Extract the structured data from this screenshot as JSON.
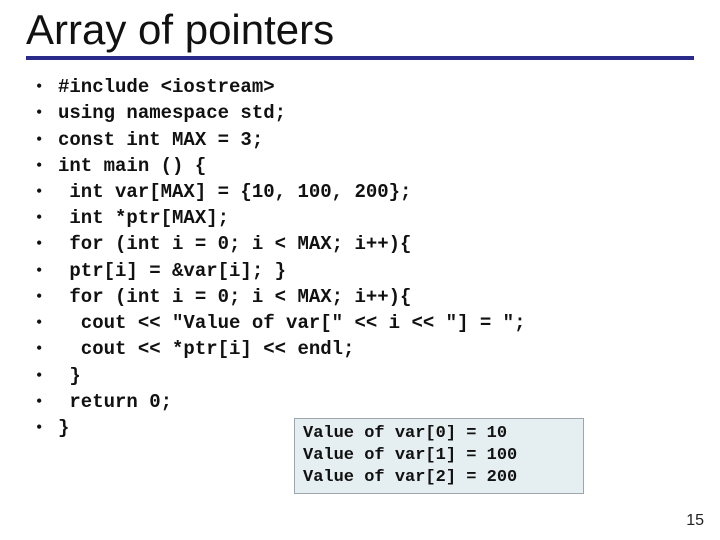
{
  "title": "Array of pointers",
  "code_lines": [
    "#include <iostream>",
    "using namespace std;",
    "const int MAX = 3;",
    "int main () {",
    " int var[MAX] = {10, 100, 200};",
    " int *ptr[MAX];",
    " for (int i = 0; i < MAX; i++){",
    " ptr[i] = &var[i]; }",
    " for (int i = 0; i < MAX; i++){",
    "  cout << \"Value of var[\" << i << \"] = \";",
    "  cout << *ptr[i] << endl;",
    " }",
    " return 0;",
    "}"
  ],
  "output_lines": [
    "Value of var[0] = 10",
    "Value of var[1] = 100",
    "Value of var[2] = 200"
  ],
  "page_number": "15"
}
